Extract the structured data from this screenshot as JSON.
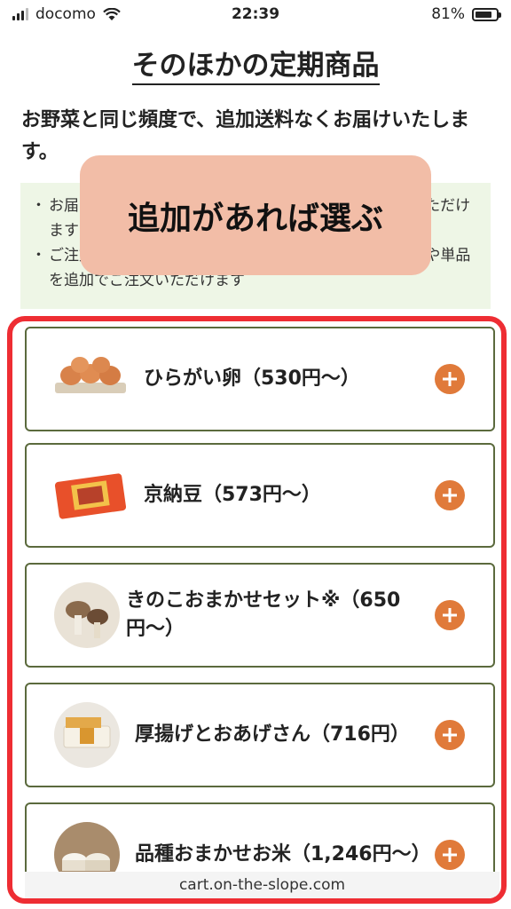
{
  "status_bar": {
    "carrier": "docomo",
    "time": "22:39",
    "battery": "81%"
  },
  "page_title": "そのほかの定期商品",
  "intro": "お野菜と同じ頻度で、追加送料なくお届けいたします。",
  "notes": [
    "お届け日の変更やお休みなど、お野菜と同じお手続きいただけます",
    "ご注文後もマイページからいつでもそのほかの定期商品や単品を追加でご注文いただけます"
  ],
  "tooltip": "追加があれば選ぶ",
  "products": [
    {
      "name": "ひらがい卵（530円〜）",
      "icon": "eggs-image"
    },
    {
      "name": "京納豆（573円〜）",
      "icon": "natto-image"
    },
    {
      "name": "きのこおまかせセット※（650円〜）",
      "icon": "mushroom-image"
    },
    {
      "name": "厚揚げとおあげさん（716円）",
      "icon": "tofu-image"
    },
    {
      "name": "品種おまかせお米（1,246円〜）",
      "icon": "rice-image"
    }
  ],
  "url": "cart.on-the-slope.com",
  "colors": {
    "highlight": "#ee2d33",
    "add_button": "#e07a3a",
    "card_border": "#5b6a3d",
    "tooltip_bg": "#f2bda7",
    "notes_bg": "#eef6e6"
  }
}
